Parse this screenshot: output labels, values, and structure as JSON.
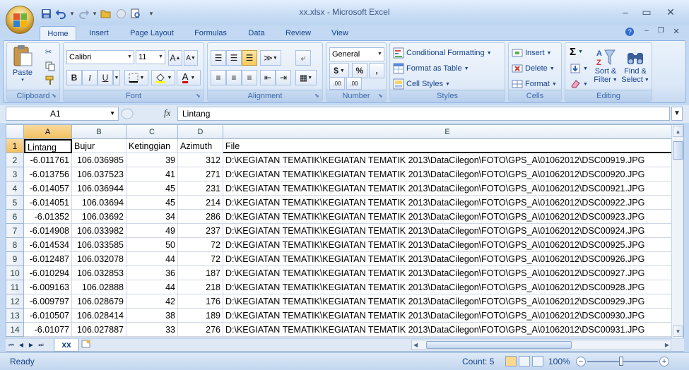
{
  "window": {
    "title": "xx.xlsx - Microsoft Excel",
    "minimize": "–",
    "restore": "▭",
    "close": "✕"
  },
  "ribbon_tabs": [
    "Home",
    "Insert",
    "Page Layout",
    "Formulas",
    "Data",
    "Review",
    "View"
  ],
  "ribbon": {
    "clipboard": {
      "label": "Clipboard",
      "paste": "Paste"
    },
    "font": {
      "label": "Font",
      "name": "Calibri",
      "size": "11",
      "bold": "B",
      "italic": "I",
      "underline": "U"
    },
    "alignment": {
      "label": "Alignment"
    },
    "number": {
      "label": "Number",
      "format": "General",
      "currency": "$",
      "percent": "%",
      "comma": ",",
      "inc_decimal": ".00",
      "dec_decimal": ".00"
    },
    "styles": {
      "label": "Styles",
      "conditional": "Conditional Formatting",
      "format_table": "Format as Table",
      "cell_styles": "Cell Styles"
    },
    "cells": {
      "label": "Cells",
      "insert": "Insert",
      "delete": "Delete",
      "format": "Format"
    },
    "editing": {
      "label": "Editing",
      "sort": "Sort &",
      "filter": "Filter",
      "find": "Find &",
      "select": "Select"
    }
  },
  "formula_bar": {
    "name_box": "A1",
    "fx": "fx",
    "formula": "Lintang"
  },
  "columns": [
    "A",
    "B",
    "C",
    "D",
    "E"
  ],
  "headers": [
    "Lintang",
    "Bujur",
    "Ketinggian",
    "Azimuth",
    "File"
  ],
  "rows": [
    {
      "n": "2",
      "a": "-6.011761",
      "b": "106.036985",
      "c": "39",
      "d": "312",
      "e": "D:\\KEGIATAN TEMATIK\\KEGIATAN TEMATIK 2013\\DataCilegon\\FOTO\\GPS_A\\01062012\\DSC00919.JPG"
    },
    {
      "n": "3",
      "a": "-6.013756",
      "b": "106.037523",
      "c": "41",
      "d": "271",
      "e": "D:\\KEGIATAN TEMATIK\\KEGIATAN TEMATIK 2013\\DataCilegon\\FOTO\\GPS_A\\01062012\\DSC00920.JPG"
    },
    {
      "n": "4",
      "a": "-6.014057",
      "b": "106.036944",
      "c": "45",
      "d": "231",
      "e": "D:\\KEGIATAN TEMATIK\\KEGIATAN TEMATIK 2013\\DataCilegon\\FOTO\\GPS_A\\01062012\\DSC00921.JPG"
    },
    {
      "n": "5",
      "a": "-6.014051",
      "b": "106.03694",
      "c": "45",
      "d": "214",
      "e": "D:\\KEGIATAN TEMATIK\\KEGIATAN TEMATIK 2013\\DataCilegon\\FOTO\\GPS_A\\01062012\\DSC00922.JPG"
    },
    {
      "n": "6",
      "a": "-6.01352",
      "b": "106.03692",
      "c": "34",
      "d": "286",
      "e": "D:\\KEGIATAN TEMATIK\\KEGIATAN TEMATIK 2013\\DataCilegon\\FOTO\\GPS_A\\01062012\\DSC00923.JPG"
    },
    {
      "n": "7",
      "a": "-6.014908",
      "b": "106.033982",
      "c": "49",
      "d": "237",
      "e": "D:\\KEGIATAN TEMATIK\\KEGIATAN TEMATIK 2013\\DataCilegon\\FOTO\\GPS_A\\01062012\\DSC00924.JPG"
    },
    {
      "n": "8",
      "a": "-6.014534",
      "b": "106.033585",
      "c": "50",
      "d": "72",
      "e": "D:\\KEGIATAN TEMATIK\\KEGIATAN TEMATIK 2013\\DataCilegon\\FOTO\\GPS_A\\01062012\\DSC00925.JPG"
    },
    {
      "n": "9",
      "a": "-6.012487",
      "b": "106.032078",
      "c": "44",
      "d": "72",
      "e": "D:\\KEGIATAN TEMATIK\\KEGIATAN TEMATIK 2013\\DataCilegon\\FOTO\\GPS_A\\01062012\\DSC00926.JPG"
    },
    {
      "n": "10",
      "a": "-6.010294",
      "b": "106.032853",
      "c": "36",
      "d": "187",
      "e": "D:\\KEGIATAN TEMATIK\\KEGIATAN TEMATIK 2013\\DataCilegon\\FOTO\\GPS_A\\01062012\\DSC00927.JPG"
    },
    {
      "n": "11",
      "a": "-6.009163",
      "b": "106.02888",
      "c": "44",
      "d": "218",
      "e": "D:\\KEGIATAN TEMATIK\\KEGIATAN TEMATIK 2013\\DataCilegon\\FOTO\\GPS_A\\01062012\\DSC00928.JPG"
    },
    {
      "n": "12",
      "a": "-6.009797",
      "b": "106.028679",
      "c": "42",
      "d": "176",
      "e": "D:\\KEGIATAN TEMATIK\\KEGIATAN TEMATIK 2013\\DataCilegon\\FOTO\\GPS_A\\01062012\\DSC00929.JPG"
    },
    {
      "n": "13",
      "a": "-6.010507",
      "b": "106.028414",
      "c": "38",
      "d": "189",
      "e": "D:\\KEGIATAN TEMATIK\\KEGIATAN TEMATIK 2013\\DataCilegon\\FOTO\\GPS_A\\01062012\\DSC00930.JPG"
    },
    {
      "n": "14",
      "a": "-6.01077",
      "b": "106.027887",
      "c": "33",
      "d": "276",
      "e": "D:\\KEGIATAN TEMATIK\\KEGIATAN TEMATIK 2013\\DataCilegon\\FOTO\\GPS_A\\01062012\\DSC00931.JPG"
    }
  ],
  "sheet": {
    "active_tab": "xx"
  },
  "status": {
    "ready": "Ready",
    "count": "Count: 5",
    "zoom": "100%",
    "zoom_out": "−",
    "zoom_in": "+"
  },
  "colors": {
    "ribbon_blue": "#c3d9f3",
    "selected_header": "#f1c15f",
    "title_text": "#3e5982"
  }
}
